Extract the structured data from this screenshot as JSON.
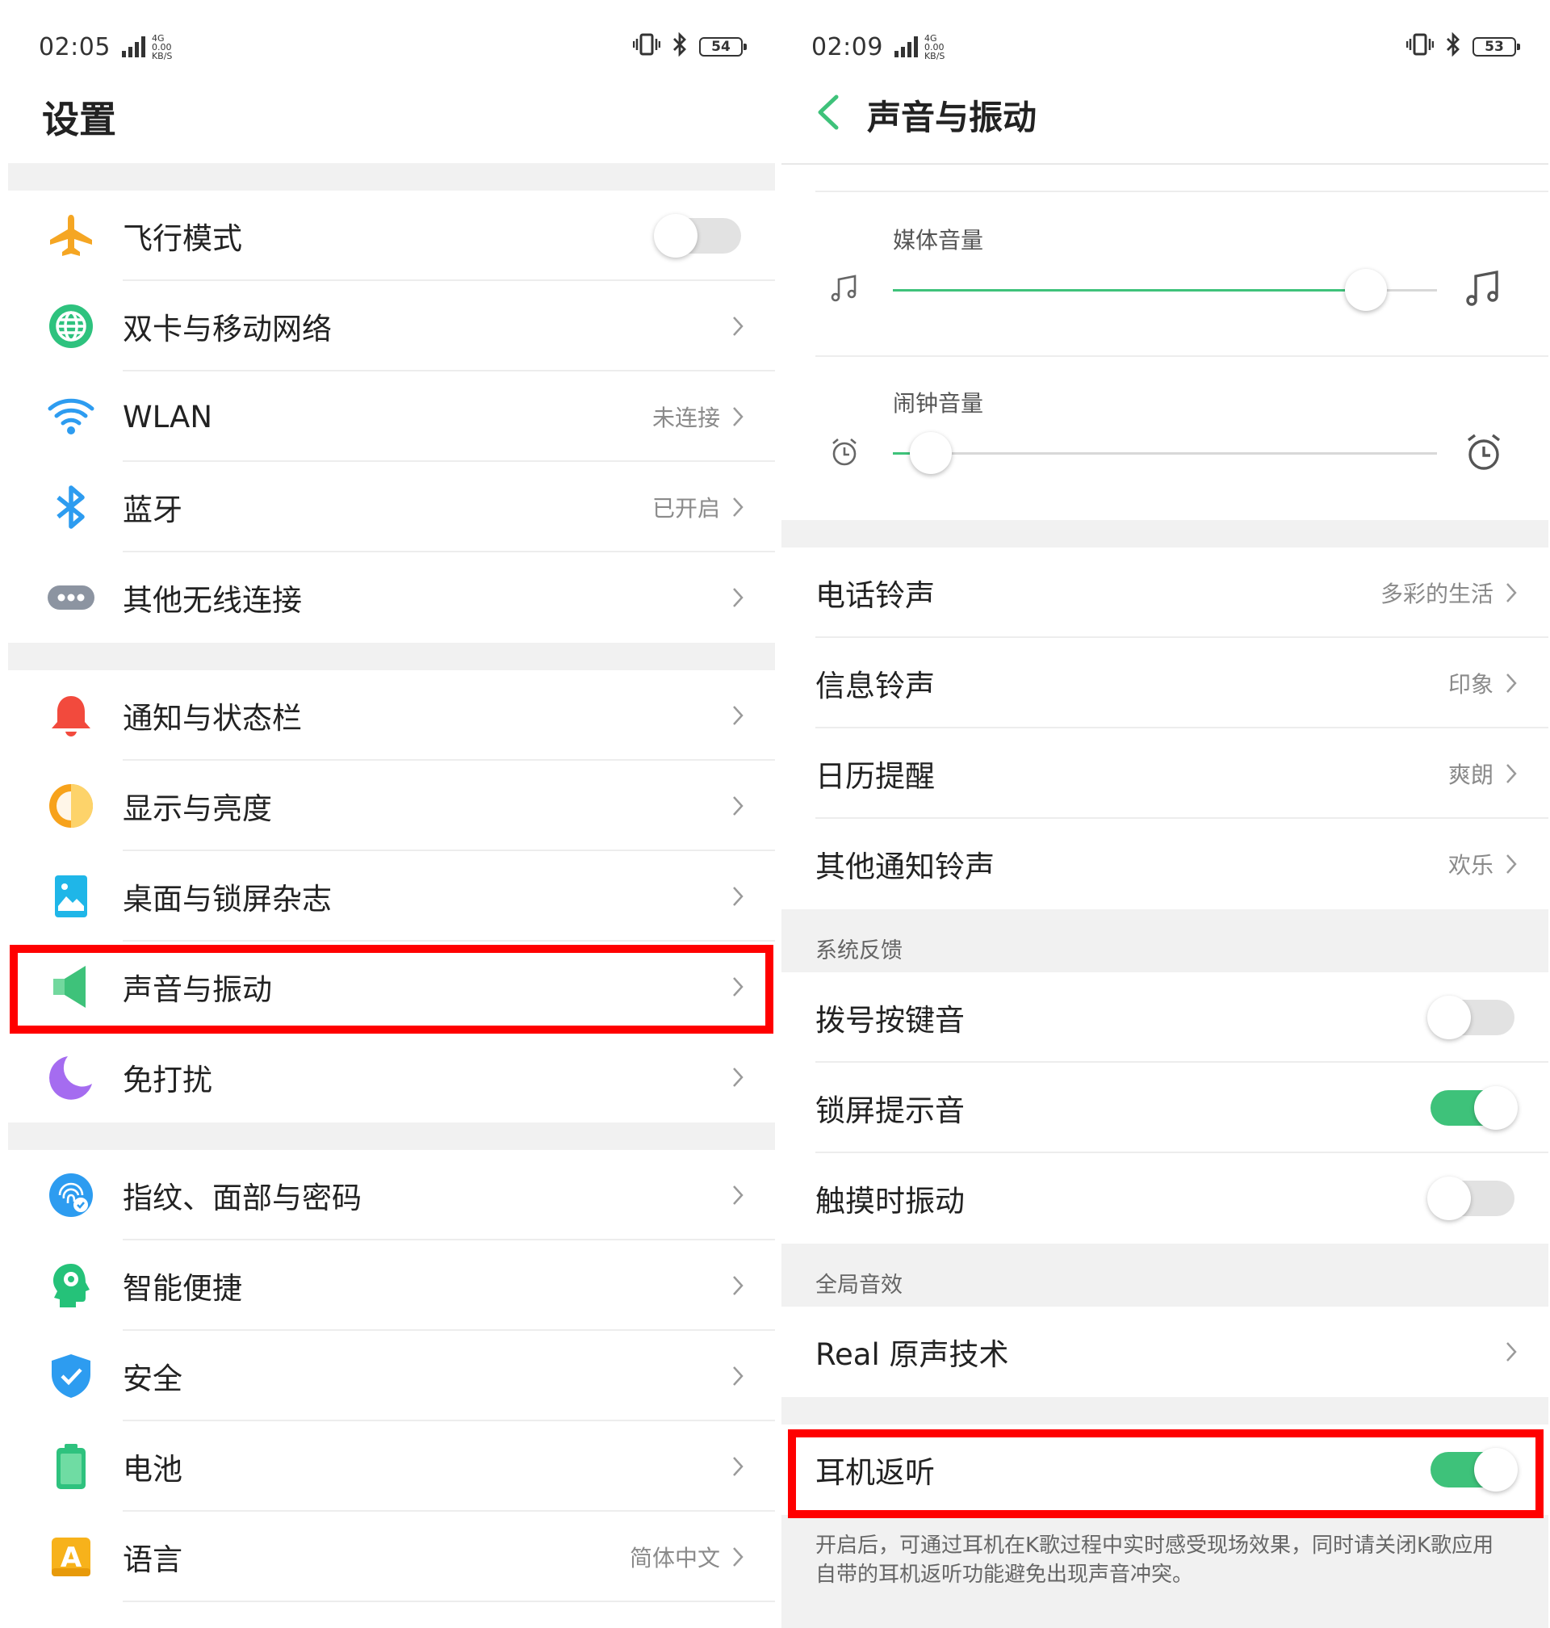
{
  "left": {
    "status": {
      "time": "02:05",
      "net_top": "4G",
      "net_speed": "0.00",
      "net_unit": "KB/S",
      "battery": "54"
    },
    "title": "设置",
    "rows": [
      {
        "label": "飞行模式",
        "icon": "airplane-icon",
        "value": "",
        "toggle": "off"
      },
      {
        "label": "双卡与移动网络",
        "icon": "globe-icon",
        "value": ""
      },
      {
        "label": "WLAN",
        "icon": "wifi-icon",
        "value": "未连接"
      },
      {
        "label": "蓝牙",
        "icon": "bluetooth-icon",
        "value": "已开启"
      },
      {
        "label": "其他无线连接",
        "icon": "more-icon",
        "value": ""
      },
      {
        "label": "通知与状态栏",
        "icon": "bell-icon",
        "value": ""
      },
      {
        "label": "显示与亮度",
        "icon": "brightness-icon",
        "value": ""
      },
      {
        "label": "桌面与锁屏杂志",
        "icon": "wallpaper-icon",
        "value": ""
      },
      {
        "label": "声音与振动",
        "icon": "speaker-icon",
        "value": ""
      },
      {
        "label": "免打扰",
        "icon": "moon-icon",
        "value": ""
      },
      {
        "label": "指纹、面部与密码",
        "icon": "fingerprint-icon",
        "value": ""
      },
      {
        "label": "智能便捷",
        "icon": "smart-head-icon",
        "value": ""
      },
      {
        "label": "安全",
        "icon": "shield-icon",
        "value": ""
      },
      {
        "label": "电池",
        "icon": "battery-icon",
        "value": ""
      },
      {
        "label": "语言",
        "icon": "language-icon",
        "value": "简体中文",
        "icon_letter": "A"
      }
    ]
  },
  "right": {
    "status": {
      "time": "02:09",
      "net_top": "4G",
      "net_speed": "0.00",
      "net_unit": "KB/S",
      "battery": "53"
    },
    "title": "声音与振动",
    "sliders": [
      {
        "label": "媒体音量",
        "icon": "music-note-icon",
        "level": 0.87
      },
      {
        "label": "闹钟音量",
        "icon": "alarm-clock-icon",
        "level": 0.07
      }
    ],
    "ringtones": [
      {
        "label": "电话铃声",
        "value": "多彩的生活"
      },
      {
        "label": "信息铃声",
        "value": "印象"
      },
      {
        "label": "日历提醒",
        "value": "爽朗"
      },
      {
        "label": "其他通知铃声",
        "value": "欢乐"
      }
    ],
    "feedback_header": "系统反馈",
    "feedback": [
      {
        "label": "拨号按键音",
        "toggle": "off"
      },
      {
        "label": "锁屏提示音",
        "toggle": "on"
      },
      {
        "label": "触摸时振动",
        "toggle": "off"
      }
    ],
    "effects_header": "全局音效",
    "real_sound": {
      "label": "Real 原声技术"
    },
    "earback": {
      "label": "耳机返听",
      "toggle": "on"
    },
    "earback_hint": "开启后，可通过耳机在K歌过程中实时感受现场效果，同时请关闭K歌应用自带的耳机返听功能避免出现声音冲突。"
  },
  "colors": {
    "accent_green": "#3ec27a",
    "highlight_red": "#ff0000",
    "airplane": "#f5a623",
    "globe": "#2ec27e",
    "wifi": "#2d9cf0",
    "bell": "#f24a3d"
  }
}
